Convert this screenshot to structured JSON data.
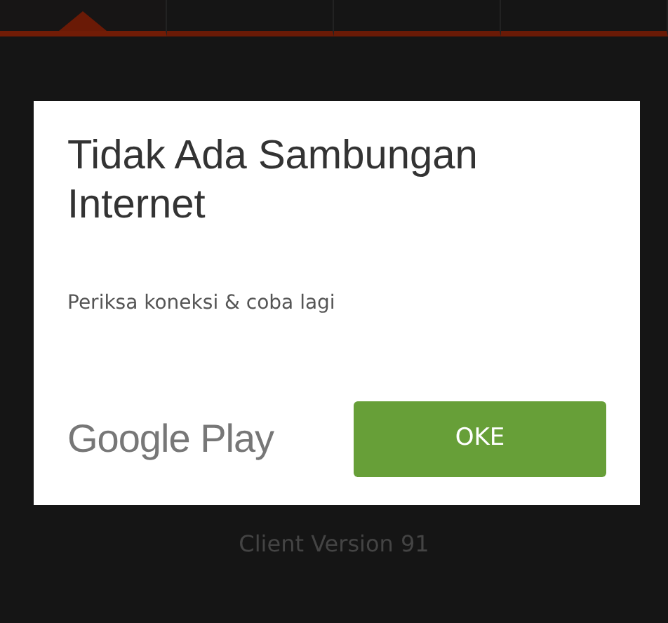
{
  "tabs": [
    {
      "selected": true
    },
    {
      "selected": false
    },
    {
      "selected": false
    },
    {
      "selected": false
    }
  ],
  "dialog": {
    "title": "Tidak Ada Sambungan Internet",
    "message": "Periksa koneksi & coba lagi",
    "brand": "Google Play",
    "button": "OKE"
  },
  "footer": "Client Version 91"
}
